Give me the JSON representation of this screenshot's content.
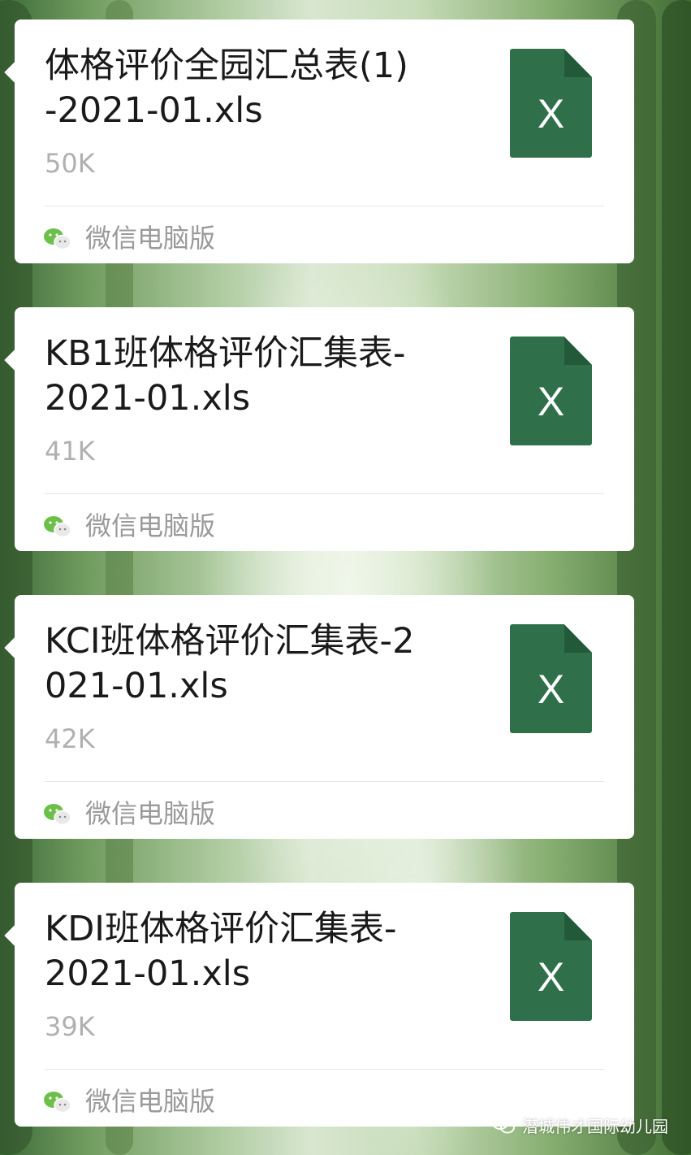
{
  "messages": [
    {
      "title": "体格评价全园汇总表(1)-2021-01.xls",
      "size": "50K",
      "file_icon_letter": "X",
      "file_icon": "excel-file-icon",
      "source": "微信电脑版"
    },
    {
      "title": "KB1班体格评价汇集表-2021-01.xls",
      "size": "41K",
      "file_icon_letter": "X",
      "file_icon": "excel-file-icon",
      "source": "微信电脑版"
    },
    {
      "title": "KCI班体格评价汇集表-2021-01.xls",
      "size": "42K",
      "file_icon_letter": "X",
      "file_icon": "excel-file-icon",
      "source": "微信电脑版"
    },
    {
      "title": "KDI班体格评价汇集表-2021-01.xls",
      "size": "39K",
      "file_icon_letter": "X",
      "file_icon": "excel-file-icon",
      "source": "微信电脑版"
    }
  ],
  "watermark": {
    "text": "潜城伟才国际幼儿园",
    "icon": "wechat-icon"
  },
  "colors": {
    "excel_green": "#2f704a",
    "card_bg": "#ffffff",
    "meta_text": "#b0b0b0"
  }
}
